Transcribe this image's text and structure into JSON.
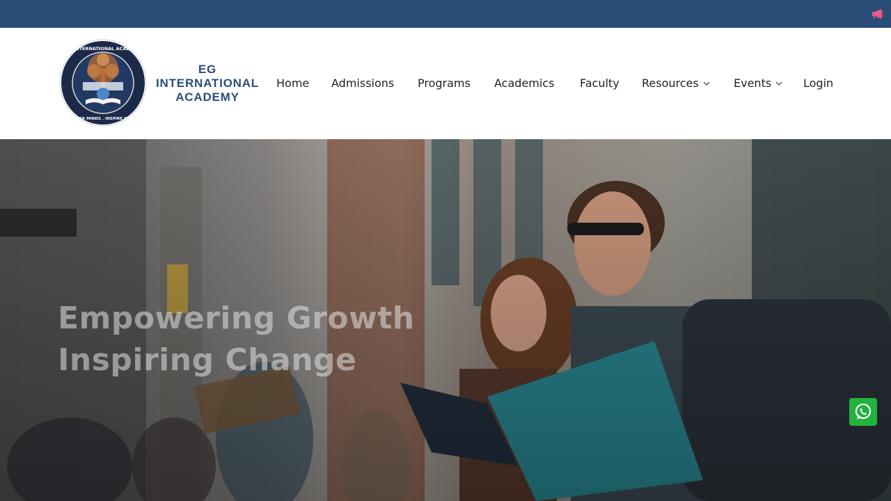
{
  "topbar": {
    "announcement_icon": "megaphone-icon",
    "color": "#2a4d77"
  },
  "brand": {
    "logo_ring_text_top": "EG INTERNATIONAL ACADEMY",
    "logo_ring_text_bottom": "EMPOWER MINDS . INSPIRE SUCCESS",
    "name_line1": "EG",
    "name_line2": "INTERNATIONAL",
    "name_line3": "ACADEMY",
    "color": "#2a4d77"
  },
  "nav": {
    "items": [
      {
        "label": "Home"
      },
      {
        "label": "Admissions"
      },
      {
        "label": "Programs"
      },
      {
        "label": "Academics"
      },
      {
        "label": "Faculty"
      },
      {
        "label": "Resources",
        "dropdown": true
      },
      {
        "label": "Events",
        "dropdown": true
      },
      {
        "label": "Login"
      }
    ]
  },
  "hero": {
    "title_line1": "Empowering Growth",
    "title_line2": "Inspiring Change"
  },
  "floating": {
    "whatsapp_icon": "whatsapp-icon",
    "color": "#22b23d"
  }
}
